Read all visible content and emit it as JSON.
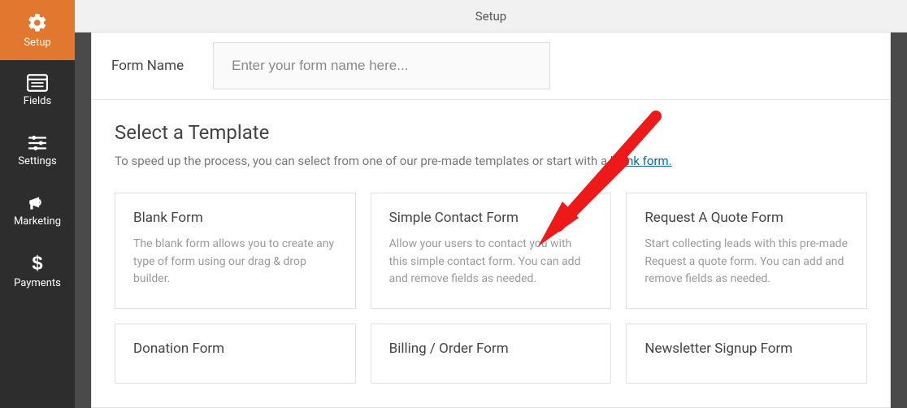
{
  "sidebar": {
    "items": [
      {
        "label": "Setup"
      },
      {
        "label": "Fields"
      },
      {
        "label": "Settings"
      },
      {
        "label": "Marketing"
      },
      {
        "label": "Payments"
      }
    ]
  },
  "topbar": {
    "title": "Setup"
  },
  "formName": {
    "label": "Form Name",
    "placeholder": "Enter your form name here...",
    "value": ""
  },
  "templates": {
    "heading": "Select a Template",
    "intro_prefix": "To speed up the process, you can select from one of our pre-made templates or start with a ",
    "intro_link": "blank form.",
    "cards": [
      {
        "title": "Blank Form",
        "desc": "The blank form allows you to create any type of form using our drag & drop builder."
      },
      {
        "title": "Simple Contact Form",
        "desc": "Allow your users to contact you with this simple contact form. You can add and remove fields as needed."
      },
      {
        "title": "Request A Quote Form",
        "desc": "Start collecting leads with this pre-made Request a quote form. You can add and remove fields as needed."
      },
      {
        "title": "Donation Form",
        "desc": ""
      },
      {
        "title": "Billing / Order Form",
        "desc": ""
      },
      {
        "title": "Newsletter Signup Form",
        "desc": ""
      }
    ]
  },
  "colors": {
    "accent": "#e27730",
    "link": "#036aab"
  }
}
